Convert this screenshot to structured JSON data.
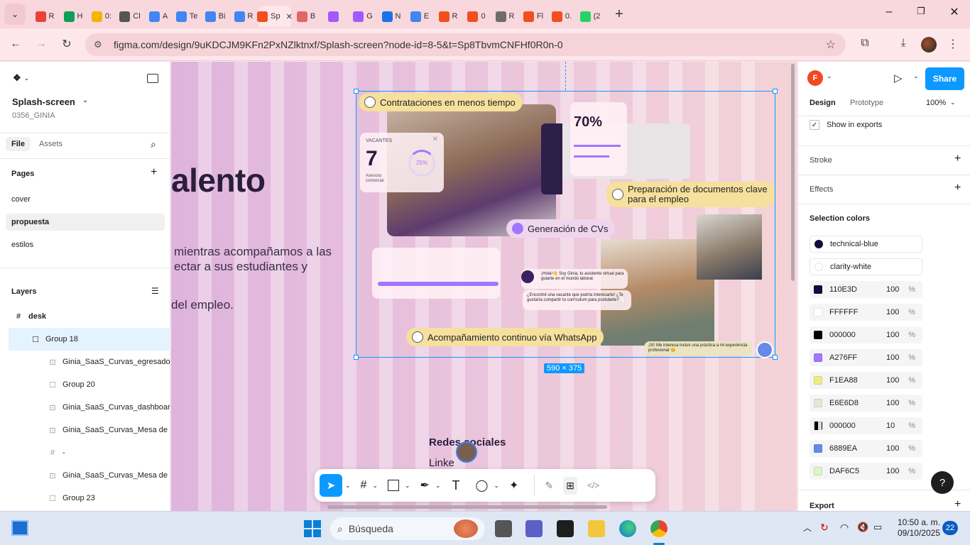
{
  "browser": {
    "tabs": [
      {
        "label": "R",
        "color": "#ea4335"
      },
      {
        "label": "H",
        "color": "#0f9d58"
      },
      {
        "label": "0:",
        "color": "#f4b400"
      },
      {
        "label": "Cl",
        "color": "#555555"
      },
      {
        "label": "A",
        "color": "#4285f4"
      },
      {
        "label": "Te",
        "color": "#4285f4"
      },
      {
        "label": "Bi",
        "color": "#4285f4"
      },
      {
        "label": "R",
        "color": "#4285f4"
      },
      {
        "label": "Sp",
        "color": "#f24e1e"
      },
      {
        "label": "B",
        "color": "#e06666"
      },
      {
        "label": "",
        "color": "#a259ff"
      },
      {
        "label": "G",
        "color": "#a259ff"
      },
      {
        "label": "N",
        "color": "#1a73e8"
      },
      {
        "label": "E",
        "color": "#4285f4"
      },
      {
        "label": "R",
        "color": "#f24e1e"
      },
      {
        "label": "0",
        "color": "#f24e1e"
      },
      {
        "label": "R",
        "color": "#6d6d6d"
      },
      {
        "label": "Fl",
        "color": "#f24e1e"
      },
      {
        "label": "0.",
        "color": "#f24e1e"
      },
      {
        "label": "(2",
        "color": "#25d366"
      }
    ],
    "active_tab_label": "Sp",
    "url": "figma.com/design/9uKDCJM9KFn2PxNZlktnxf/Splash-screen?node-id=8-5&t=Sp8TbvmCNFHf0R0n-0"
  },
  "left_panel": {
    "file_name": "Splash-screen",
    "file_sub": "0356_GINIA",
    "tab_file": "File",
    "tab_assets": "Assets",
    "pages_title": "Pages",
    "pages": [
      "cover",
      "propuesta",
      "estilos"
    ],
    "selected_page": "propuesta",
    "layers_title": "Layers",
    "layers": [
      {
        "name": "desk",
        "type": "frame"
      },
      {
        "name": "Group 18",
        "type": "group"
      },
      {
        "name": "Ginia_SaaS_Curvas_egresado",
        "type": "image"
      },
      {
        "name": "Group 20",
        "type": "group"
      },
      {
        "name": "Ginia_SaaS_Curvas_dashboar",
        "type": "image"
      },
      {
        "name": "Ginia_SaaS_Curvas_Mesa de",
        "type": "image"
      },
      {
        "name": "-",
        "type": "frame"
      },
      {
        "name": "Ginia_SaaS_Curvas_Mesa de",
        "type": "image"
      },
      {
        "name": "Group 23",
        "type": "group"
      }
    ]
  },
  "canvas": {
    "heading_fragment": "alento",
    "body_line1": "mientras acompañamos a las",
    "body_line2": "ectar a sus estudiantes y",
    "body_line3": "del empleo.",
    "selection_size": "590 × 375",
    "social_title": "Redes sociales",
    "social_link": "Linke",
    "pills": {
      "p1": "Contrataciones en menos tiempo",
      "p2_l1": "Preparación de documentos clave",
      "p2_l2": "para el empleo",
      "p3": "Generación de CVs",
      "p4": "Acompañamiento continuo vía WhatsApp"
    },
    "vacantes_label": "VACANTES",
    "vacantes_value": "7",
    "vacantes_sub": "Asesora comercial",
    "vacantes_pct": "25%",
    "stat_value": "70%",
    "chat_1": "¡Hola!👋 Soy Ginia, tu asistente virtual para guiarte en el mundo laboral.",
    "chat_2": "¿Encontré una vacante que podría interesarte! ¿Te gustaría compartir tu currículum para postularte? 📄",
    "chat_3": "¡Sí! Me interesa incluir una práctica a mi experiencia profesional 😊"
  },
  "toolbar": {
    "tools": [
      "move",
      "frame",
      "rectangle",
      "pen",
      "text",
      "shape",
      "actions",
      "draw",
      "dev-mode",
      "code"
    ]
  },
  "right_panel": {
    "avatar_letter": "F",
    "share_label": "Share",
    "tab_design": "Design",
    "tab_prototype": "Prototype",
    "zoom": "100%",
    "show_in_exports": "Show in exports",
    "stroke": "Stroke",
    "effects": "Effects",
    "selection_colors": "Selection colors",
    "styles": [
      {
        "name": "technical-blue",
        "color": "#110E3D"
      },
      {
        "name": "clarity-white",
        "color": "#FFFFFF"
      }
    ],
    "colors": [
      {
        "hex": "110E3D",
        "opacity": "100",
        "color": "#110E3D"
      },
      {
        "hex": "FFFFFF",
        "opacity": "100",
        "color": "#FFFFFF"
      },
      {
        "hex": "000000",
        "opacity": "100",
        "color": "#000000"
      },
      {
        "hex": "A276FF",
        "opacity": "100",
        "color": "#A276FF"
      },
      {
        "hex": "F1EA88",
        "opacity": "100",
        "color": "#F1EA88"
      },
      {
        "hex": "E6E6D8",
        "opacity": "100",
        "color": "#E6E6D8"
      },
      {
        "hex": "000000",
        "opacity": "10",
        "color": "#000000"
      },
      {
        "hex": "6889EA",
        "opacity": "100",
        "color": "#6889EA"
      },
      {
        "hex": "DAF6C5",
        "opacity": "100",
        "color": "#DAF6C5"
      }
    ],
    "percent_sign": "%",
    "export": "Export",
    "help": "?"
  },
  "taskbar": {
    "search_placeholder": "Búsqueda",
    "time": "10:50 a. m.",
    "date": "09/10/2025",
    "notifications": "22"
  },
  "accent": "#0d99ff"
}
